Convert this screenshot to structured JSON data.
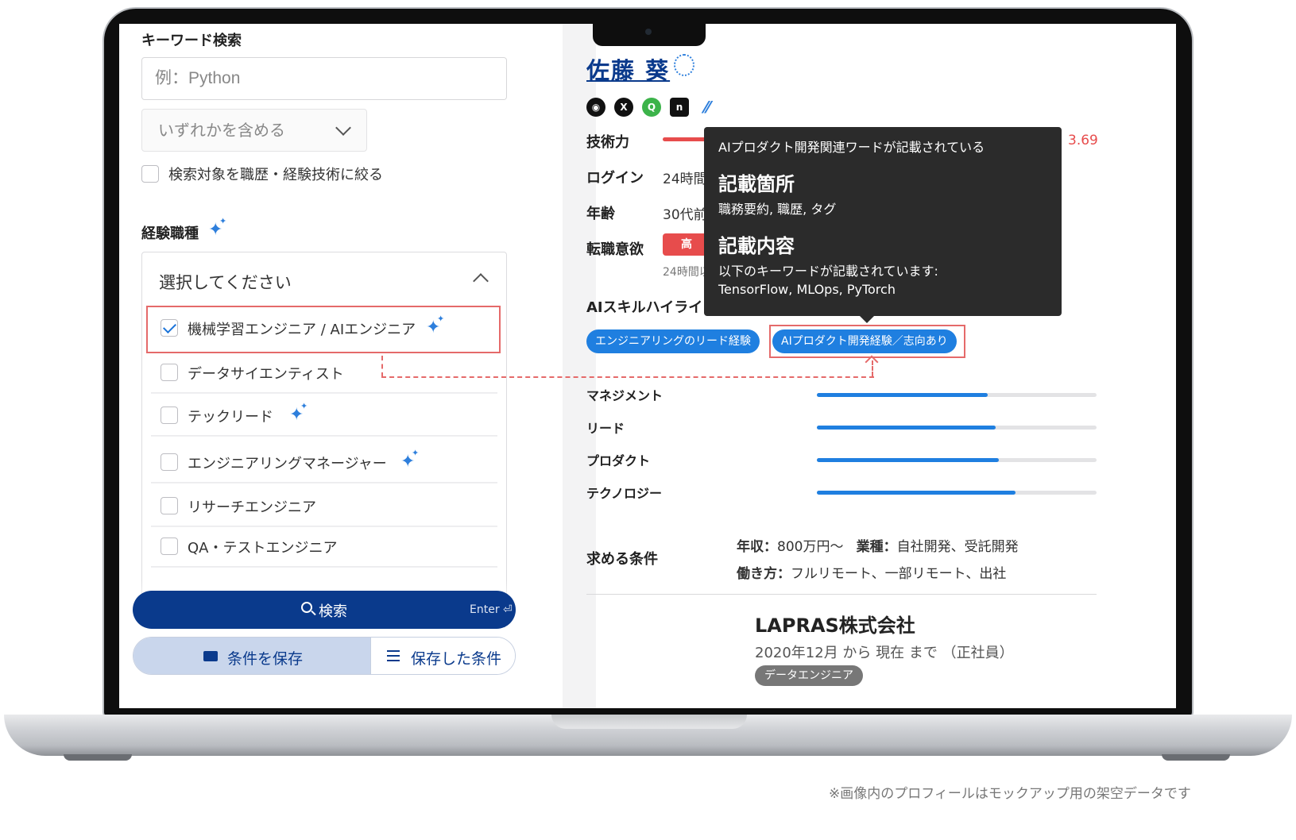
{
  "search": {
    "keyword_label": "キーワード検索",
    "keyword_placeholder": "例：Python",
    "match_mode": "いずれかを含める",
    "restrict_checkbox": "検索対象を職歴・経験技術に絞る",
    "job_type_label": "経験職種",
    "job_type_placeholder": "選択してください",
    "job_options": [
      {
        "label": "機械学習エンジニア / AIエンジニア",
        "checked": true,
        "ai": true
      },
      {
        "label": "データサイエンティスト",
        "checked": false,
        "ai": false
      },
      {
        "label": "テックリード",
        "checked": false,
        "ai": true
      },
      {
        "label": "エンジニアリングマネージャー",
        "checked": false,
        "ai": true
      },
      {
        "label": "リサーチエンジニア",
        "checked": false,
        "ai": false
      },
      {
        "label": "QA・テストエンジニア",
        "checked": false,
        "ai": false
      }
    ],
    "search_button": "検索",
    "enter_hint": "Enter ⏎",
    "save_button": "条件を保存",
    "saved_button": "保存した条件"
  },
  "profile": {
    "name": "佐藤 葵",
    "social_icons": [
      "github-icon",
      "x-icon",
      "qiita-icon",
      "note-icon",
      "zenn-icon"
    ],
    "tech_label": "技術力",
    "tech_score": "3.69",
    "login_label": "ログイン",
    "login_value": "24時間",
    "age_label": "年齢",
    "age_value": "30代前",
    "intent_label": "転職意欲",
    "intent_badge": "高",
    "intent_sub": "24時間以",
    "ai_skill_label": "AIスキルハイライ",
    "tags": [
      "エンジニアリングのリード経験",
      "AIプロダクト開発経験／志向あり"
    ],
    "skills": [
      {
        "label": "マネジメント",
        "level": 0.61
      },
      {
        "label": "リード",
        "level": 0.64
      },
      {
        "label": "プロダクト",
        "level": 0.65
      },
      {
        "label": "テクノロジー",
        "level": 0.71
      }
    ],
    "conditions_label": "求める条件",
    "conditions": {
      "salary_key": "年収：",
      "salary_value": "800万円〜",
      "industry_key": "業種：",
      "industry_value": "自社開発、受託開発",
      "workstyle_key": "働き方：",
      "workstyle_value": "フルリモート、一部リモート、出社"
    },
    "company": "LAPRAS株式会社",
    "period": "2020年12月 から 現在 まで （正社員）",
    "role": "データエンジニア"
  },
  "tooltip": {
    "title": "AIプロダクト開発関連ワードが記載されている",
    "location_heading": "記載箇所",
    "location_text": "職務要約, 職歴, タグ",
    "content_heading": "記載内容",
    "content_text1": "以下のキーワードが記載されています:",
    "content_text2": "TensorFlow, MLOps, PyTorch"
  },
  "disclaimer": "※画像内のプロフィールはモックアップ用の架空データです",
  "colors": {
    "primary": "#0a3a8c",
    "accent": "#1f7fe0",
    "highlight": "#e56a6a",
    "score": "#e74c4c"
  }
}
